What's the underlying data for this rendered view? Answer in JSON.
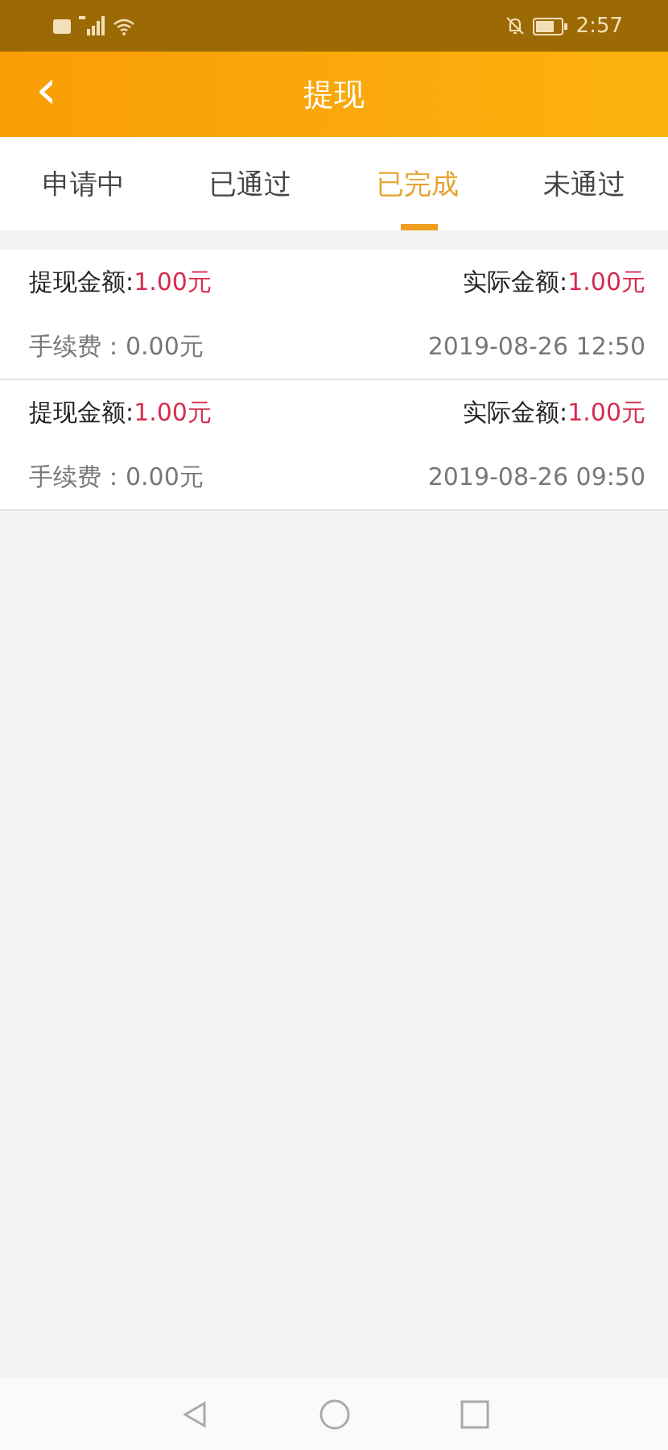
{
  "status_bar": {
    "time": "2:57"
  },
  "header": {
    "back": "‹",
    "title": "提现"
  },
  "tabs": [
    {
      "label": "申请中",
      "selected": false
    },
    {
      "label": "已通过",
      "selected": false
    },
    {
      "label": "已完成",
      "selected": true
    },
    {
      "label": "未通过",
      "selected": false
    }
  ],
  "records": [
    {
      "amount_label": "提现金额:",
      "amount": "1.00元",
      "actual_label": "实际金额:",
      "actual": "1.00元",
      "fee": "手续费：0.00元",
      "time": "2019-08-26 12:50"
    },
    {
      "amount_label": "提现金额:",
      "amount": "1.00元",
      "actual_label": "实际金额:",
      "actual": "1.00元",
      "fee": "手续费：0.00元",
      "time": "2019-08-26 09:50"
    }
  ]
}
